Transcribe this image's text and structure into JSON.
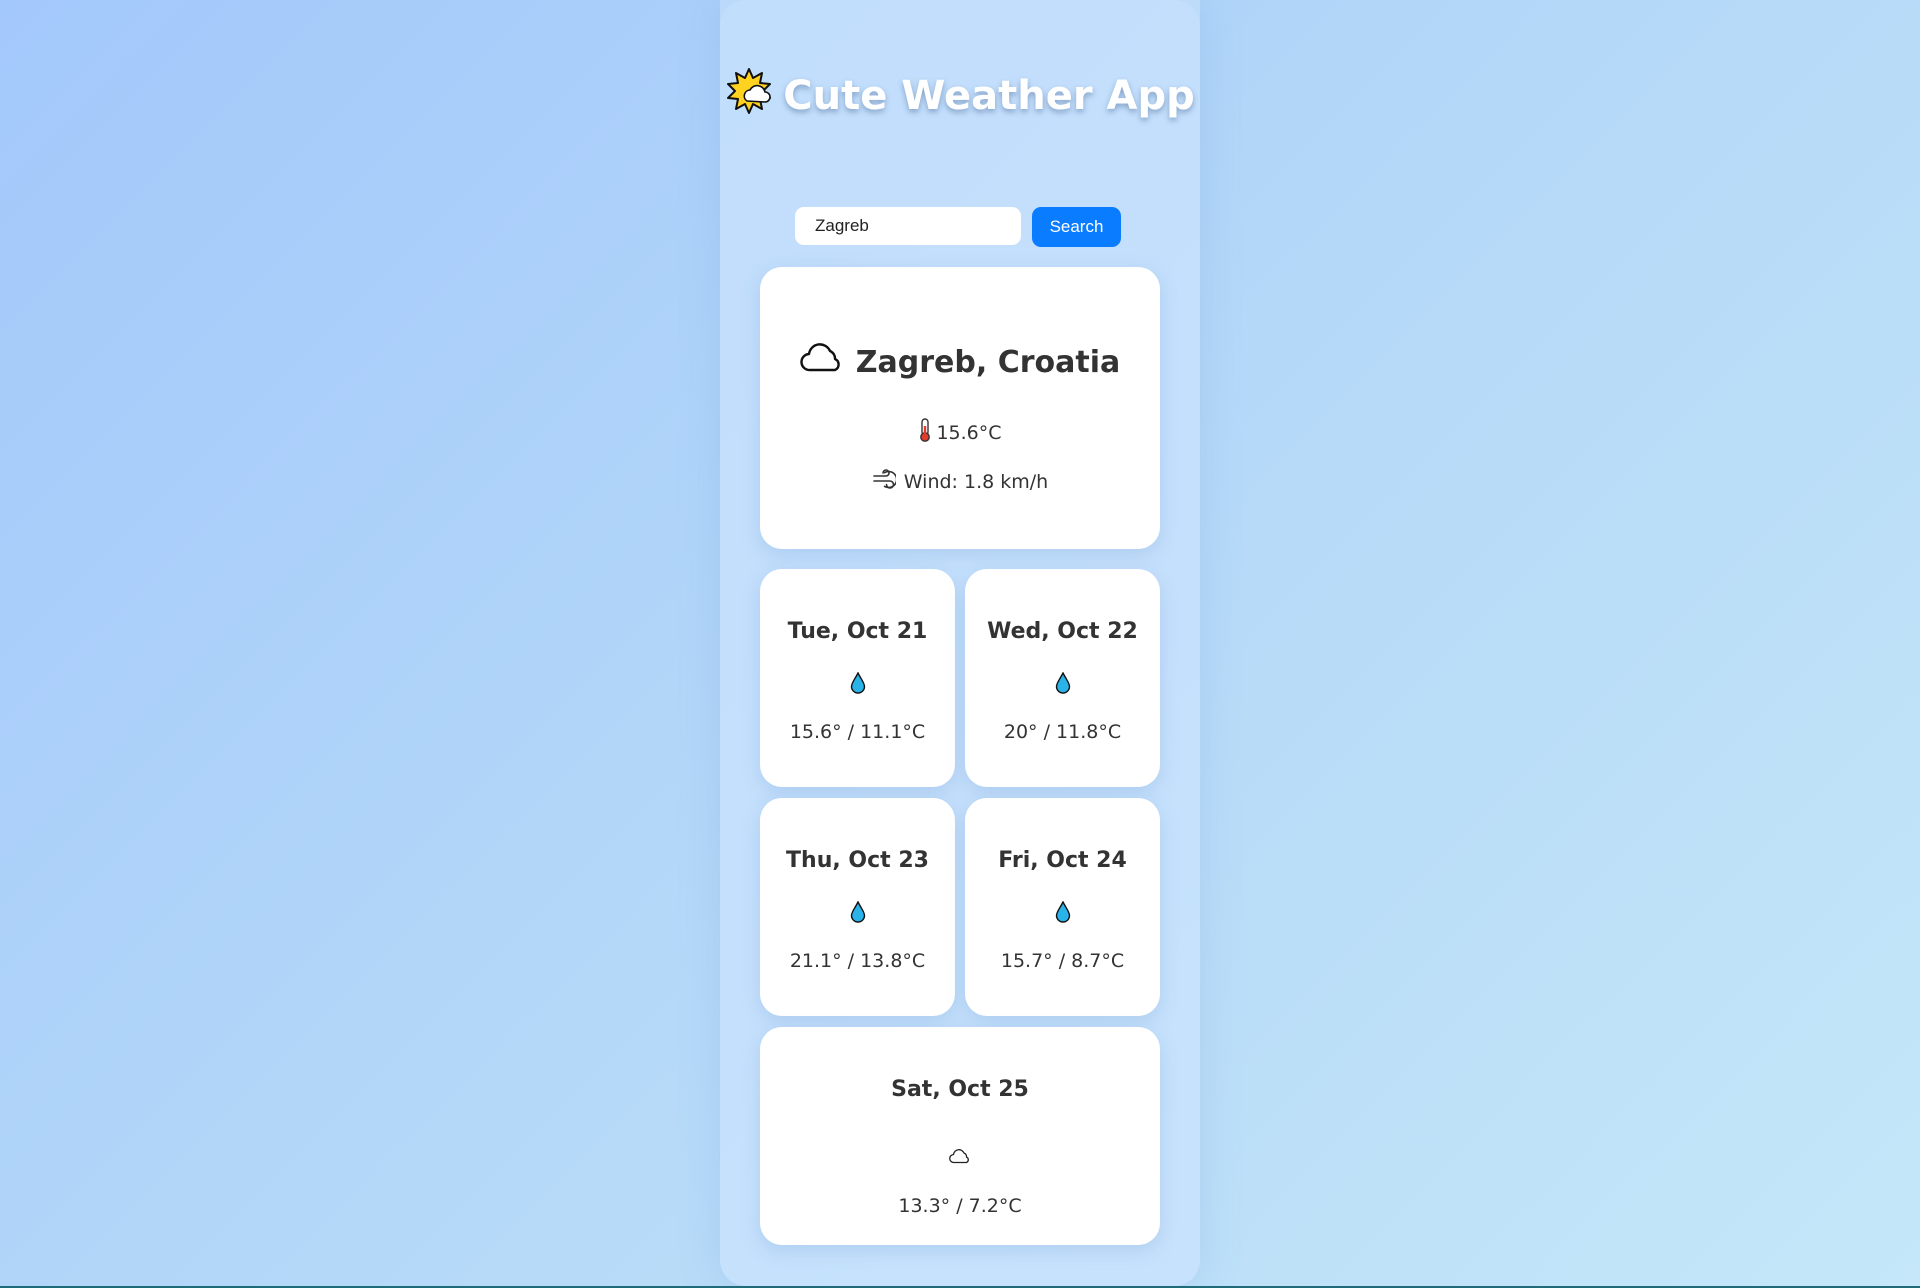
{
  "app": {
    "title": "Cute Weather App",
    "title_icon": "sun-behind-cloud-icon"
  },
  "search": {
    "value": "Zagreb",
    "button_label": "Search"
  },
  "current": {
    "condition_icon": "cloud-icon",
    "location": "Zagreb, Croatia",
    "temperature_icon": "thermometer-icon",
    "temperature": "15.6°C",
    "wind_icon": "wind-icon",
    "wind": "Wind: 1.8 km/h"
  },
  "forecast": [
    {
      "date": "Tue, Oct 21",
      "icon": "raindrop-icon",
      "range": "15.6° / 11.1°C"
    },
    {
      "date": "Wed, Oct 22",
      "icon": "raindrop-icon",
      "range": "20° / 11.8°C"
    },
    {
      "date": "Thu, Oct 23",
      "icon": "raindrop-icon",
      "range": "21.1° / 13.8°C"
    },
    {
      "date": "Fri, Oct 24",
      "icon": "raindrop-icon",
      "range": "15.7° / 8.7°C"
    },
    {
      "date": "Sat, Oct 25",
      "icon": "cloud-icon",
      "range": "13.3° / 7.2°C"
    }
  ],
  "colors": {
    "accent": "#0a7cff",
    "raindrop": "#2ab3e8",
    "text": "#333333"
  }
}
